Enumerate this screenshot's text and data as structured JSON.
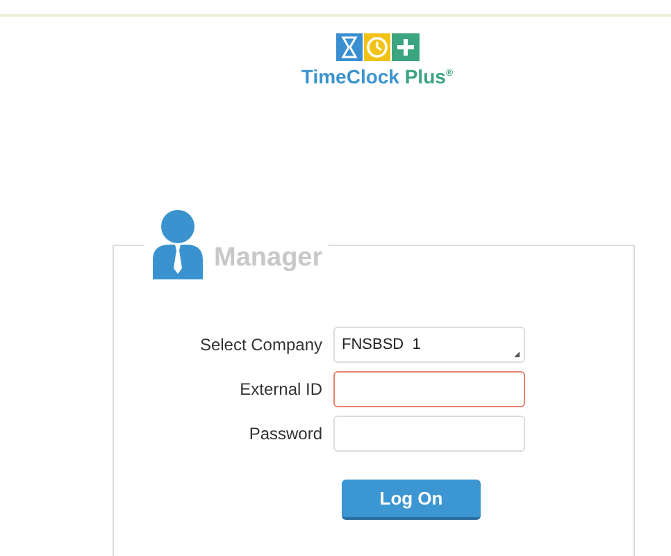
{
  "logo": {
    "brand": "TimeClock",
    "brand_accent": "Plus",
    "mark": "®"
  },
  "panel": {
    "title": "Manager"
  },
  "fields": [
    {
      "kind": "select",
      "label": "Select Company",
      "value": "FNSBSD  1",
      "invalid": false
    },
    {
      "kind": "text",
      "label": "External ID",
      "invalid": true
    },
    {
      "kind": "password",
      "label": "Password",
      "invalid": false
    }
  ],
  "submit": {
    "label": "Log On"
  }
}
